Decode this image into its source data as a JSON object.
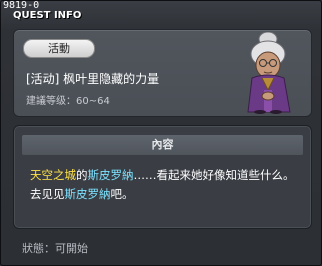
{
  "window": {
    "quest_id": "9819-0",
    "title": "QUEST INFO"
  },
  "quest": {
    "category": "活動",
    "name": "[活动] 枫叶里隐藏的力量",
    "level": "建議等级：60~64",
    "npc_icon": "elderly-npc-portrait-icon"
  },
  "content": {
    "header": "內容",
    "segments": [
      {
        "text": "天空之城",
        "color": "#ffe34a"
      },
      {
        "text": "的",
        "color": "#ffffff"
      },
      {
        "text": "斯皮罗納",
        "color": "#7ee2ff"
      },
      {
        "text": "……看起来她好像知道些什么。去见见",
        "color": "#ffffff"
      },
      {
        "text": "斯皮罗納",
        "color": "#7ee2ff"
      },
      {
        "text": "吧。",
        "color": "#ffffff"
      }
    ]
  },
  "status": {
    "text": "狀態：可開始"
  }
}
